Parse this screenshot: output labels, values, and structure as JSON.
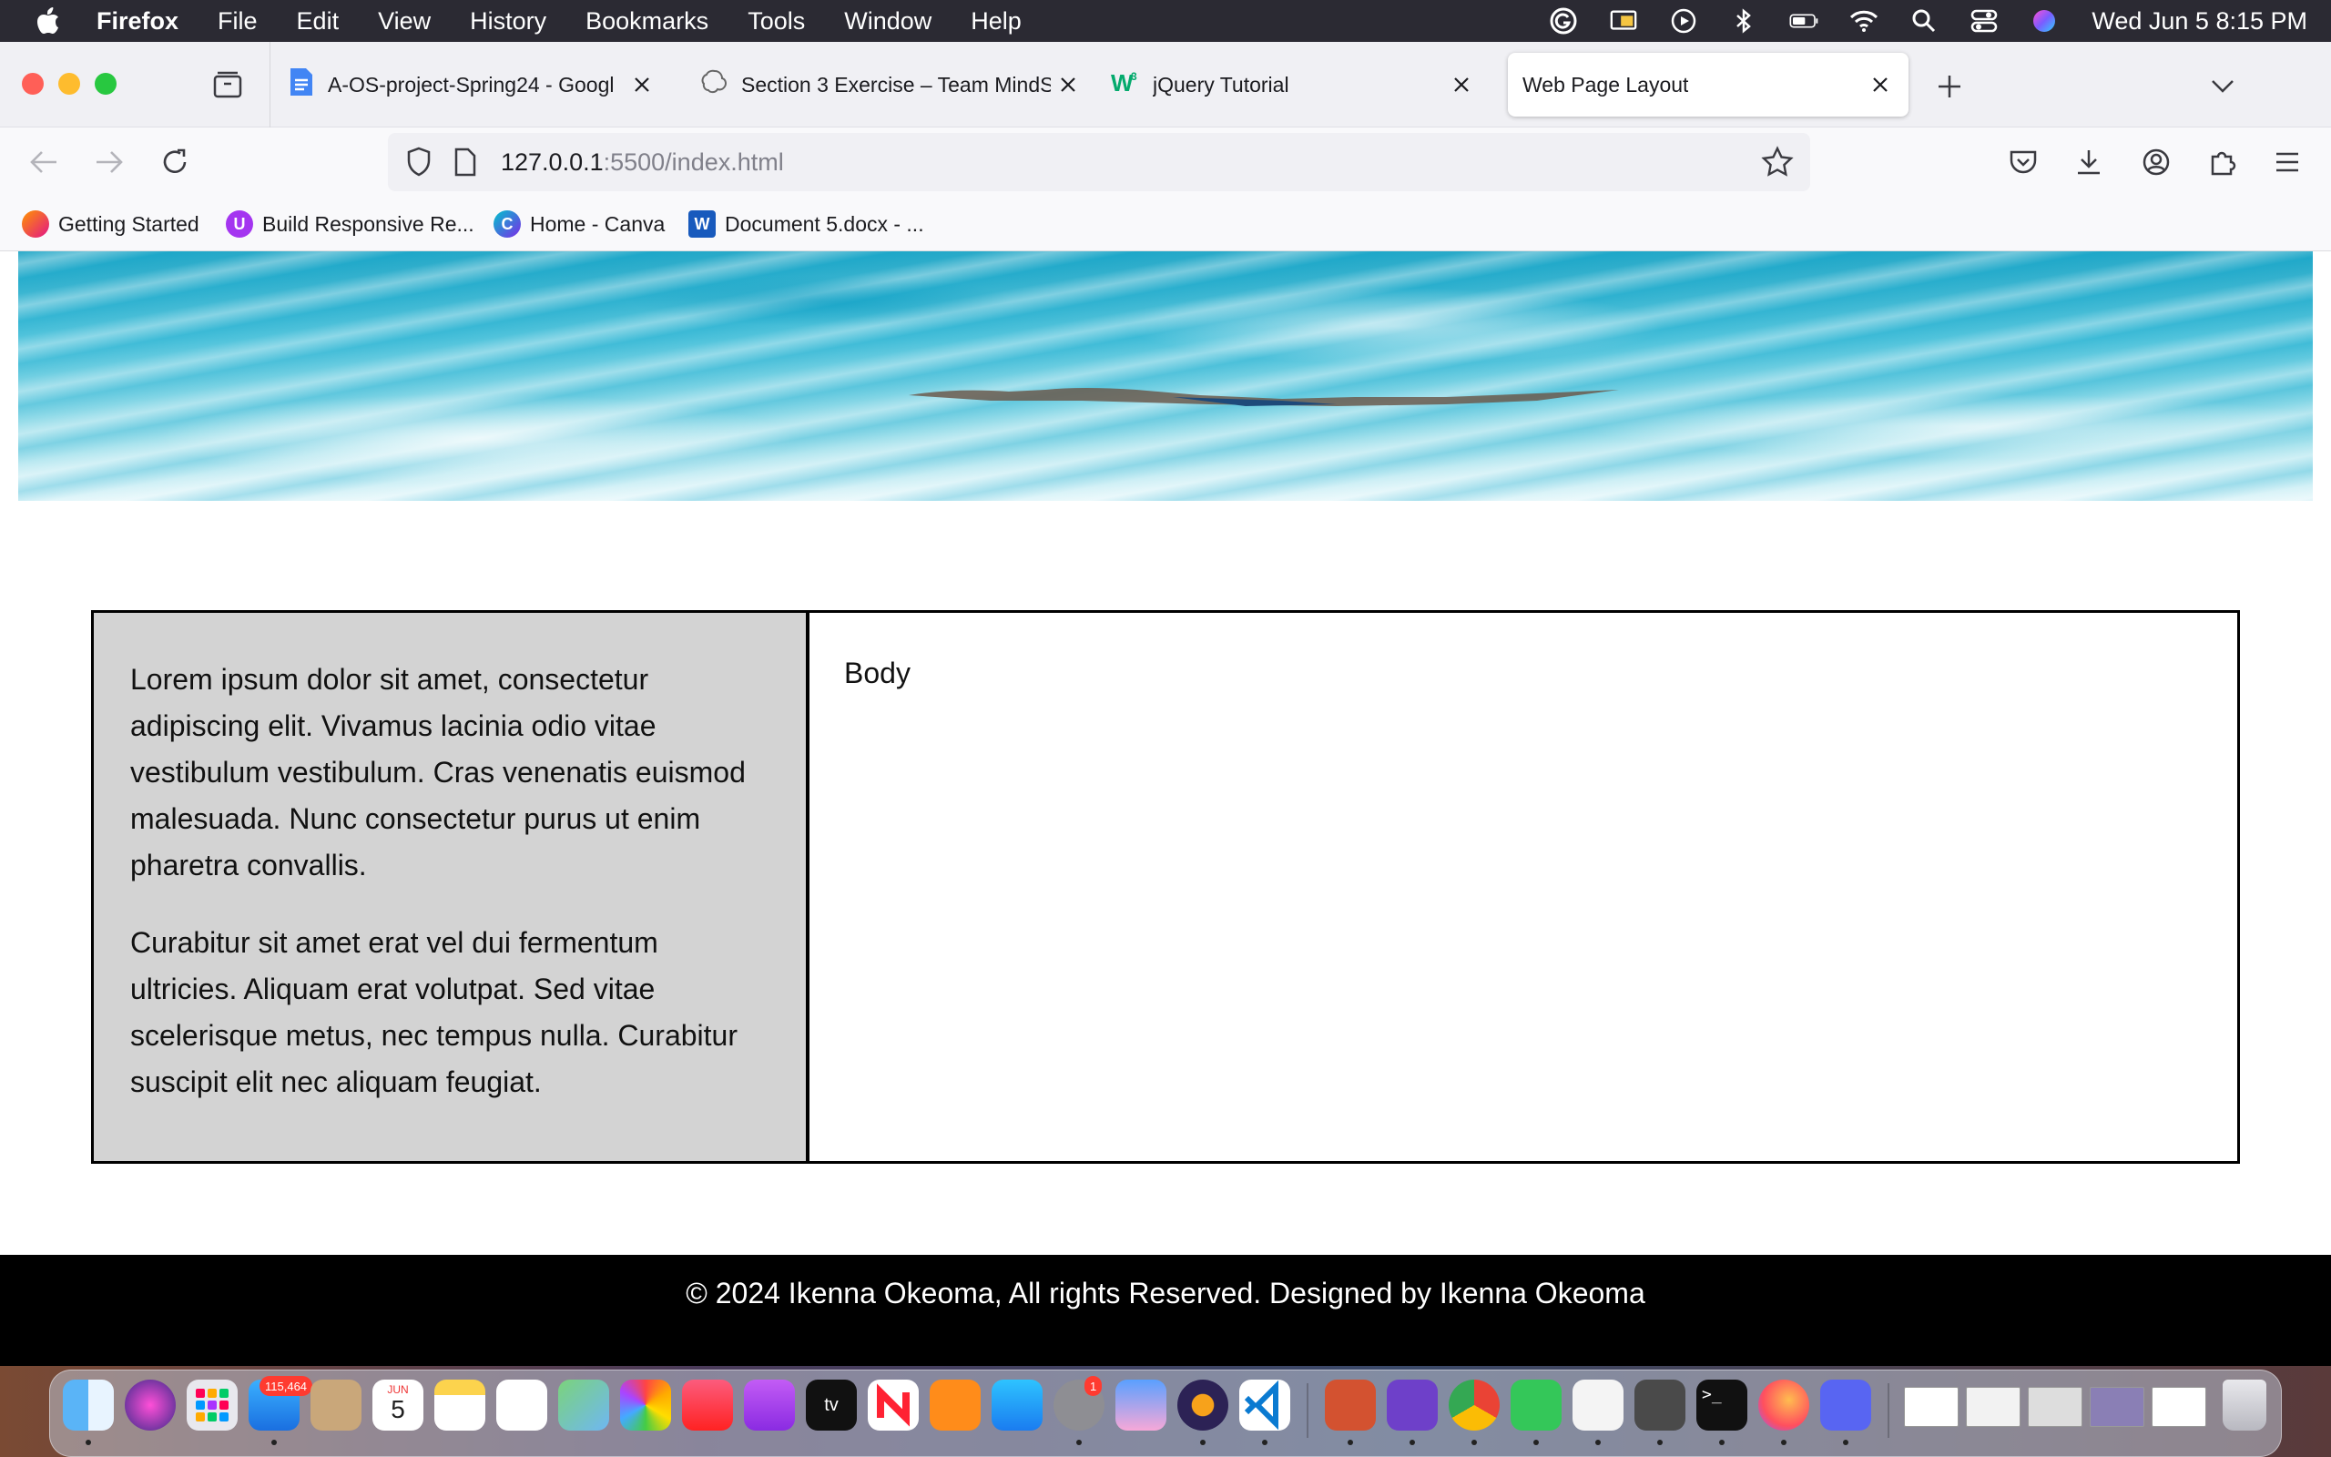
{
  "menubar": {
    "app_name": "Firefox",
    "items": [
      "File",
      "Edit",
      "View",
      "History",
      "Bookmarks",
      "Tools",
      "Window",
      "Help"
    ],
    "clock": "Wed Jun 5  8:15 PM",
    "status_icons": [
      "grammarly-icon",
      "cast-icon",
      "play-icon",
      "bluetooth-icon",
      "battery-icon",
      "wifi-icon",
      "spotlight-icon",
      "control-center-icon",
      "siri-icon"
    ]
  },
  "tabs": [
    {
      "title": "A-OS-project-Spring24 - Googl",
      "icon": "google-docs-icon",
      "active": false
    },
    {
      "title": "Section 3 Exercise – Team MindS",
      "icon": "openai-icon",
      "active": false
    },
    {
      "title": "jQuery Tutorial",
      "icon": "w3schools-icon",
      "active": false
    },
    {
      "title": "Web Page Layout",
      "icon": "",
      "active": true
    }
  ],
  "urlbar": {
    "host": "127.0.0.1",
    "rest": ":5500/index.html"
  },
  "bookmarks": [
    "Getting Started",
    "Build Responsive Re...",
    "Home - Canva",
    "Document 5.docx - ..."
  ],
  "page": {
    "sidebar_paragraphs": [
      "Lorem ipsum dolor sit amet, consectetur adipiscing elit. Vivamus lacinia odio vitae vestibulum vestibulum. Cras venenatis euismod malesuada. Nunc consectetur purus ut enim pharetra convallis.",
      "Curabitur sit amet erat vel dui fermentum ultricies. Aliquam erat volutpat. Sed vitae scelerisque metus, nec tempus nulla. Curabitur suscipit elit nec aliquam feugiat."
    ],
    "main_text": "Body",
    "footer_text": "© 2024 Ikenna Okeoma, All rights Reserved. Designed by Ikenna Okeoma"
  },
  "dock": {
    "apps": [
      "Finder",
      "Siri",
      "Launchpad",
      "Mail",
      "Contacts",
      "Calendar",
      "Notes",
      "Reminders",
      "Maps",
      "Photos",
      "Music",
      "Podcasts",
      "TV",
      "News",
      "Books",
      "App Store",
      "System Settings",
      "Keynote",
      "Eclipse",
      "VS Code",
      "PowerPoint",
      "GitHub Desktop",
      "Chrome",
      "Messages",
      "TextEdit",
      "Xcode Tools",
      "Terminal",
      "Firefox",
      "Discord"
    ],
    "mail_badge": "115,464",
    "settings_badge": "1",
    "calendar_month": "JUN",
    "calendar_day": "5"
  }
}
